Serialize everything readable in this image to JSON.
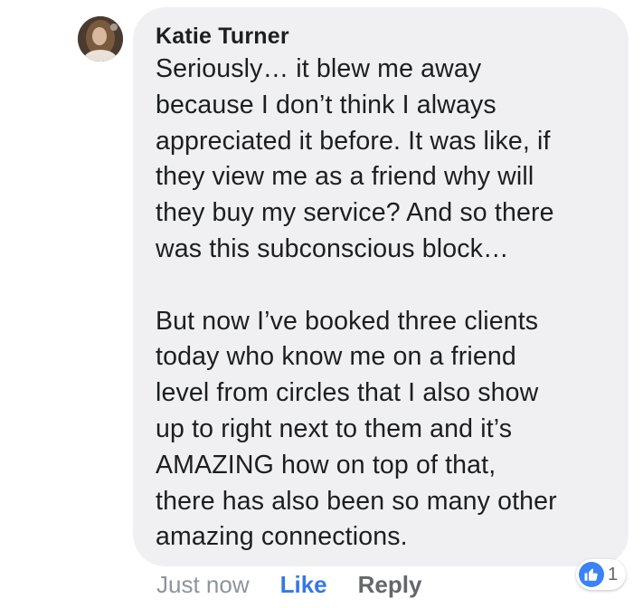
{
  "comment": {
    "author": "Katie Turner",
    "paragraphs": [
      [
        "Seriously… it blew me away",
        "because I don’t think I always",
        "appreciated it before. It was like, if",
        "they view me as a friend why will",
        "they buy my service? And so there",
        "was this subconscious block…"
      ],
      [
        "But now I’ve booked three clients",
        "today who know me on a friend",
        "level from circles that I also show",
        "up to right next to them and it’s",
        "AMAZING how on top of that,",
        "there has also been so many other",
        "amazing connections."
      ]
    ],
    "avatar_icon": "profile-photo"
  },
  "actions": {
    "timestamp": "Just now",
    "like_label": "Like",
    "reply_label": "Reply"
  },
  "reactions": {
    "icon": "thumbs-up-icon",
    "count": "1",
    "badge_color": "#3b82f6"
  },
  "colors": {
    "bubble": "#f0f0f2",
    "like_link": "#3578e5",
    "muted": "#8d949e"
  }
}
